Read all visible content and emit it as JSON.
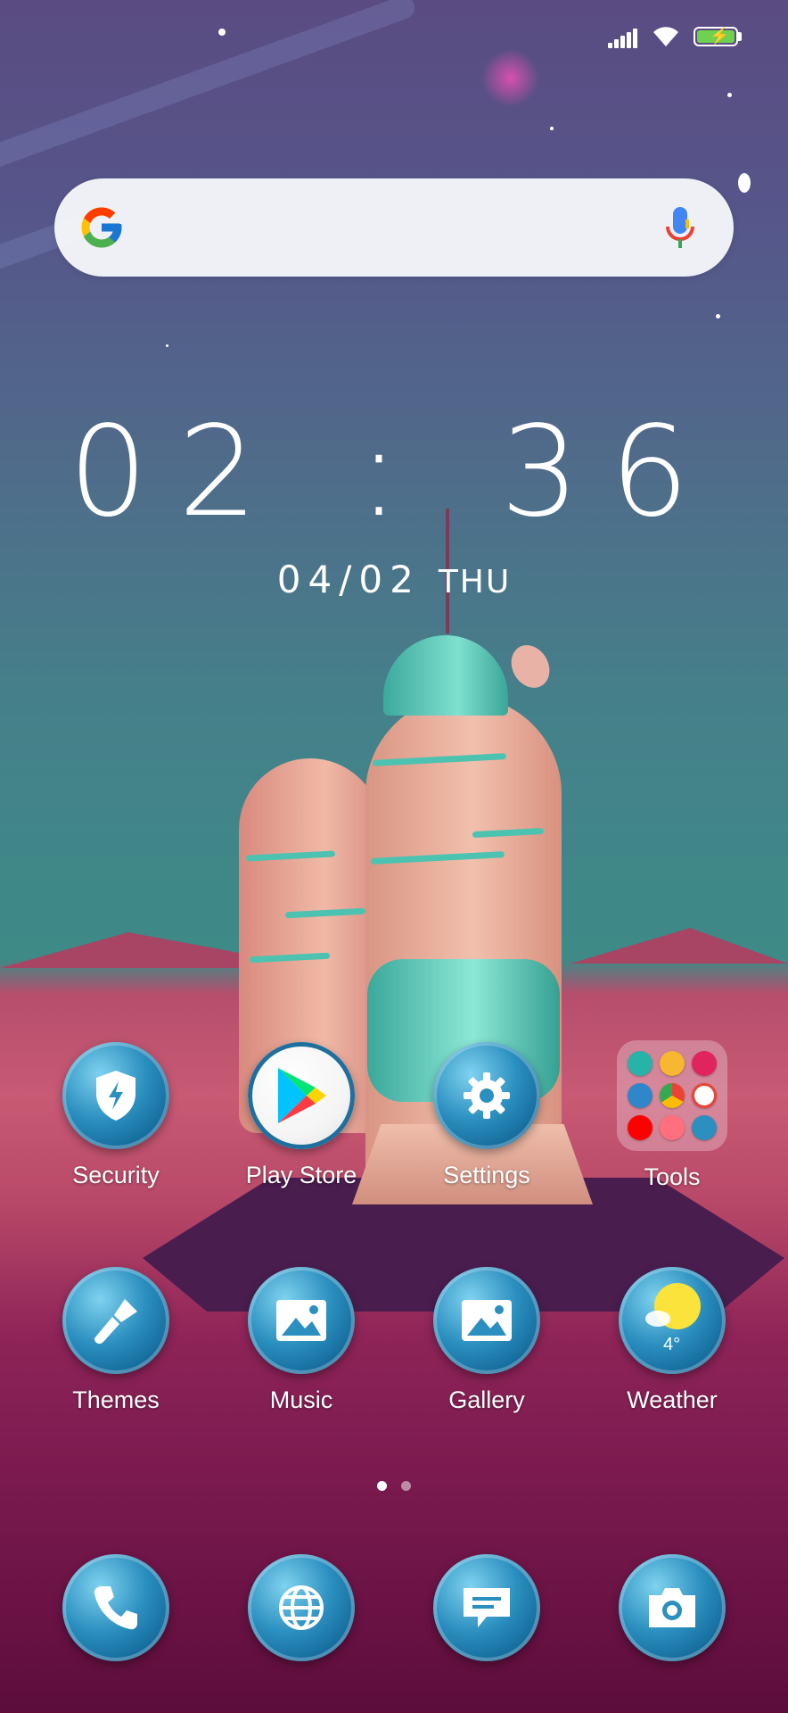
{
  "status_bar": {
    "signal_icon": "signal-bars-icon",
    "wifi_icon": "wifi-icon",
    "battery_icon": "battery-charging-icon"
  },
  "search": {
    "logo_icon": "google-g-icon",
    "mic_icon": "microphone-icon",
    "value": "",
    "placeholder": ""
  },
  "clock": {
    "time": "02 : 36",
    "date": "04/02",
    "day": "THU"
  },
  "home_row1": [
    {
      "label": "Security",
      "icon": "shield-icon"
    },
    {
      "label": "Play Store",
      "icon": "play-store-icon"
    },
    {
      "label": "Settings",
      "icon": "gear-icon"
    },
    {
      "label": "Tools",
      "icon": "folder-icon"
    }
  ],
  "home_row2": [
    {
      "label": "Themes",
      "icon": "paintbrush-icon"
    },
    {
      "label": "Music",
      "icon": "image-icon"
    },
    {
      "label": "Gallery",
      "icon": "image-icon"
    },
    {
      "label": "Weather",
      "icon": "weather-icon",
      "temp": "4°"
    }
  ],
  "folder_apps": [
    "screen-recorder-icon",
    "play-games-icon",
    "play-movies-icon",
    "contacts-icon",
    "chrome-icon",
    "gmail-icon",
    "youtube-icon",
    "health-icon",
    "video-call-icon"
  ],
  "pages": {
    "count": 2,
    "active": 1
  },
  "dock": [
    {
      "icon": "phone-icon"
    },
    {
      "icon": "globe-icon"
    },
    {
      "icon": "message-icon"
    },
    {
      "icon": "camera-icon"
    }
  ],
  "colors": {
    "icon_blue": "#2b8fbf",
    "sky_top": "#5a4c82",
    "ground": "#c85a74",
    "ground_dark": "#5c0d3b"
  }
}
